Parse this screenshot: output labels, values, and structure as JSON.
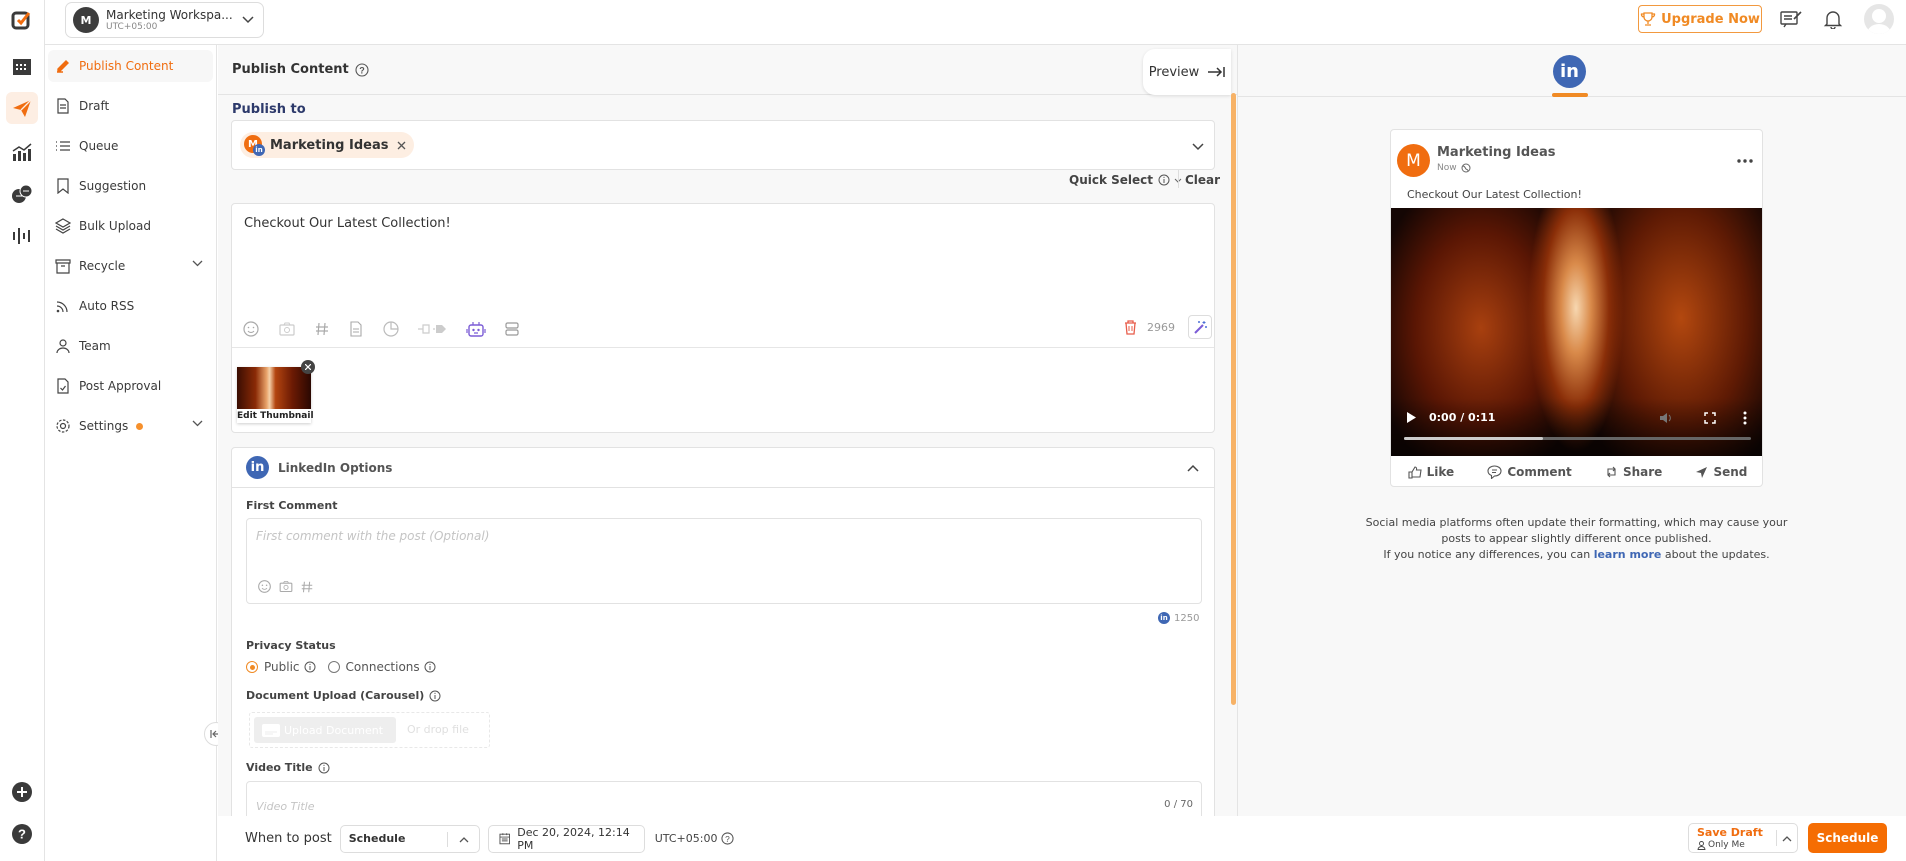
{
  "workspace": {
    "initial": "M",
    "name": "Marketing Workspa...",
    "timezone": "UTC+05:00"
  },
  "topbar": {
    "upgrade_label": "Upgrade Now"
  },
  "rail": {
    "items": [
      {
        "icon": "logo-icon"
      },
      {
        "icon": "calendar-icon"
      },
      {
        "icon": "paper-plane-icon",
        "active": true
      },
      {
        "icon": "analytics-icon"
      },
      {
        "icon": "chat-bubbles-icon"
      },
      {
        "icon": "audio-wave-icon"
      }
    ],
    "bottom": [
      {
        "icon": "plus-circle-icon"
      },
      {
        "icon": "help-circle-icon"
      }
    ]
  },
  "sidebar": {
    "items": [
      {
        "label": "Publish Content",
        "icon": "pencil-icon",
        "active": true
      },
      {
        "label": "Draft",
        "icon": "document-icon"
      },
      {
        "label": "Queue",
        "icon": "list-icon"
      },
      {
        "label": "Suggestion",
        "icon": "bookmark-icon"
      },
      {
        "label": "Bulk Upload",
        "icon": "layers-icon"
      },
      {
        "label": "Recycle",
        "icon": "archive-icon",
        "expandable": true
      },
      {
        "label": "Auto RSS",
        "icon": "rss-icon"
      },
      {
        "label": "Team",
        "icon": "user-icon"
      },
      {
        "label": "Post Approval",
        "icon": "approval-doc-icon"
      },
      {
        "label": "Settings",
        "icon": "gear-icon",
        "expandable": true,
        "badge_dot": true
      }
    ]
  },
  "editor": {
    "title": "Publish Content",
    "preview_label": "Preview",
    "publish_to_label": "Publish to",
    "selected_account": {
      "name": "Marketing Ideas",
      "initial": "M",
      "network": "linkedin"
    },
    "quick_select_label": "Quick Select",
    "clear_label": "Clear",
    "post_text": "Checkout Our Latest Collection!",
    "char_count": "2969",
    "thumbnail_label": "Edit Thumbnail",
    "linkedin_options": {
      "title": "LinkedIn Options",
      "first_comment_label": "First Comment",
      "first_comment_placeholder": "First comment with the post (Optional)",
      "first_comment_count": "1250",
      "privacy_label": "Privacy Status",
      "privacy_options": [
        {
          "label": "Public",
          "selected": true
        },
        {
          "label": "Connections",
          "selected": false
        }
      ],
      "document_upload_label": "Document Upload (Carousel)",
      "upload_button": "Upload Document",
      "drop_label": "Or drop file",
      "video_title_label": "Video Title",
      "video_title_placeholder": "Video Title",
      "video_title_count": "0 / 70"
    }
  },
  "preview": {
    "account_name": "Marketing Ideas",
    "initial": "M",
    "time": "Now",
    "text": "Checkout Our Latest Collection!",
    "video_time": "0:00 / 0:11",
    "video_progress": 0.4,
    "actions": [
      "Like",
      "Comment",
      "Share",
      "Send"
    ],
    "notice_line1": "Social media platforms often update their formatting, which may cause your",
    "notice_line2": "posts to appear slightly different once published.",
    "notice_line3_pre": "If you notice any differences, you can",
    "notice_link": "learn more",
    "notice_line3_post": "about the updates."
  },
  "bottom": {
    "when_label": "When to post",
    "mode": "Schedule",
    "datetime": "Dec 20, 2024, 12:14 PM",
    "timezone": "UTC+05:00",
    "save_draft": "Save Draft",
    "save_scope": "Only Me",
    "schedule_button": "Schedule"
  },
  "colors": {
    "accent": "#f06d10",
    "linkedin": "#3f67b4",
    "ai": "#7b5cd6"
  }
}
